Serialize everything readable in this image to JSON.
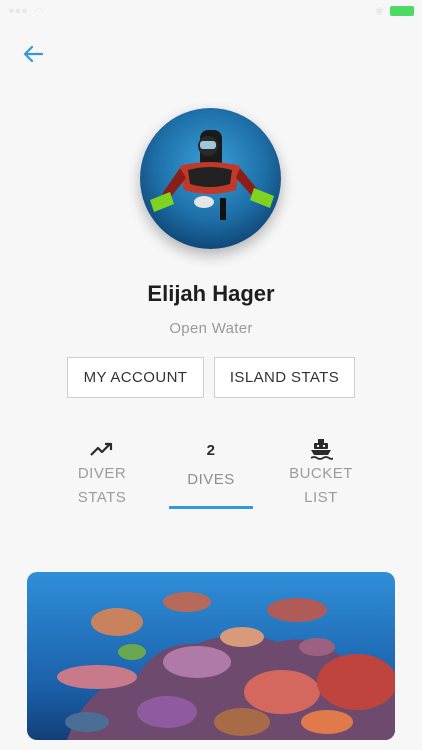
{
  "profile": {
    "name": "Elijah Hager",
    "level": "Open Water"
  },
  "buttons": {
    "my_account": "MY ACCOUNT",
    "island_stats": "ISLAND STATS"
  },
  "tabs": {
    "diver_stats": {
      "line1": "DIVER",
      "line2": "STATS",
      "icon": "trending-up-icon"
    },
    "dives": {
      "count": "2",
      "label": "DIVES",
      "selected": true
    },
    "bucket_list": {
      "line1": "BUCKET",
      "line2": "LIST",
      "icon": "boat-icon"
    }
  },
  "colors": {
    "accent": "#3498db",
    "battery": "#4cd964",
    "background": "#f7f7f7"
  }
}
